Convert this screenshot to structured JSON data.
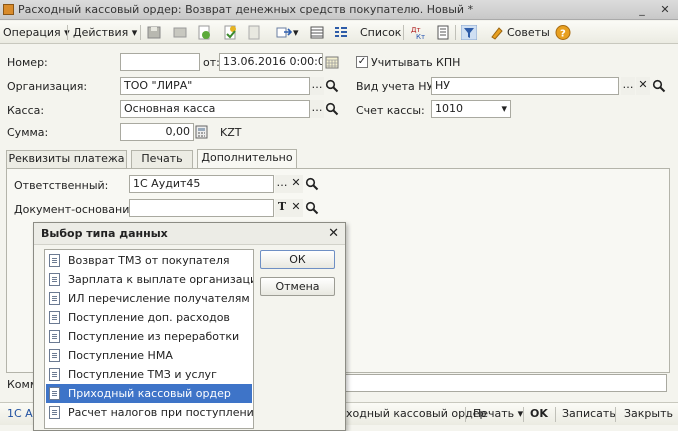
{
  "window": {
    "title": "Расходный кассовый ордер: Возврат денежных средств покупателю. Новый *",
    "minimize": "_",
    "close": "✕"
  },
  "toolbar": {
    "operation": "Операция",
    "actions": "Действия",
    "list": "Список",
    "tips": "Советы",
    "dropdown_glyph": "▾"
  },
  "form": {
    "number_label": "Номер:",
    "number_value": "",
    "date_label": "от:",
    "date_value": "13.06.2016  0:00:00",
    "kpn_label": "Учитывать КПН",
    "kpn_checked": true,
    "org_label": "Организация:",
    "org_value": "ТОО \"ЛИРА\"",
    "nu_label": "Вид учета НУ:",
    "nu_value": "НУ",
    "cash_label": "Касса:",
    "cash_value": "Основная касса",
    "account_label": "Счет кассы:",
    "account_value": "1010",
    "sum_label": "Сумма:",
    "sum_value": "0,00",
    "currency": "KZT"
  },
  "tabs": [
    {
      "label": "Реквизиты платежа",
      "active": false
    },
    {
      "label": "Печать",
      "active": false
    },
    {
      "label": "Дополнительно",
      "active": true
    }
  ],
  "extra": {
    "responsible_label": "Ответственный:",
    "responsible_value": "1С Аудит45",
    "basis_label": "Документ-основание:",
    "basis_value": "",
    "comment_label": "Комм"
  },
  "bottom": {
    "author": "1С А",
    "print_doc": "ходный кассовый ордер",
    "print": "Печать",
    "ok": "OK",
    "save": "Записать",
    "close": "Закрыть"
  },
  "dialog": {
    "title": "Выбор типа данных",
    "ok": "ОК",
    "cancel": "Отмена",
    "items": [
      {
        "label": "Возврат ТМЗ от покупателя",
        "selected": false
      },
      {
        "label": "Зарплата к выплате организаций",
        "selected": false
      },
      {
        "label": "ИЛ перечисление получателям",
        "selected": false
      },
      {
        "label": "Поступление доп. расходов",
        "selected": false
      },
      {
        "label": "Поступление из переработки",
        "selected": false
      },
      {
        "label": "Поступление НМА",
        "selected": false
      },
      {
        "label": "Поступление ТМЗ и услуг",
        "selected": false
      },
      {
        "label": "Приходный кассовый ордер",
        "selected": true
      },
      {
        "label": "Расчет налогов при поступлении ...",
        "selected": false
      }
    ]
  },
  "icons": {
    "select": "…",
    "search": "🔍",
    "clear": "✕",
    "text_type": "T",
    "calendar": "▦",
    "calculator": "▦",
    "help": "?"
  },
  "colors": {
    "selection": "#3e74c8",
    "help": "#e8a020"
  }
}
